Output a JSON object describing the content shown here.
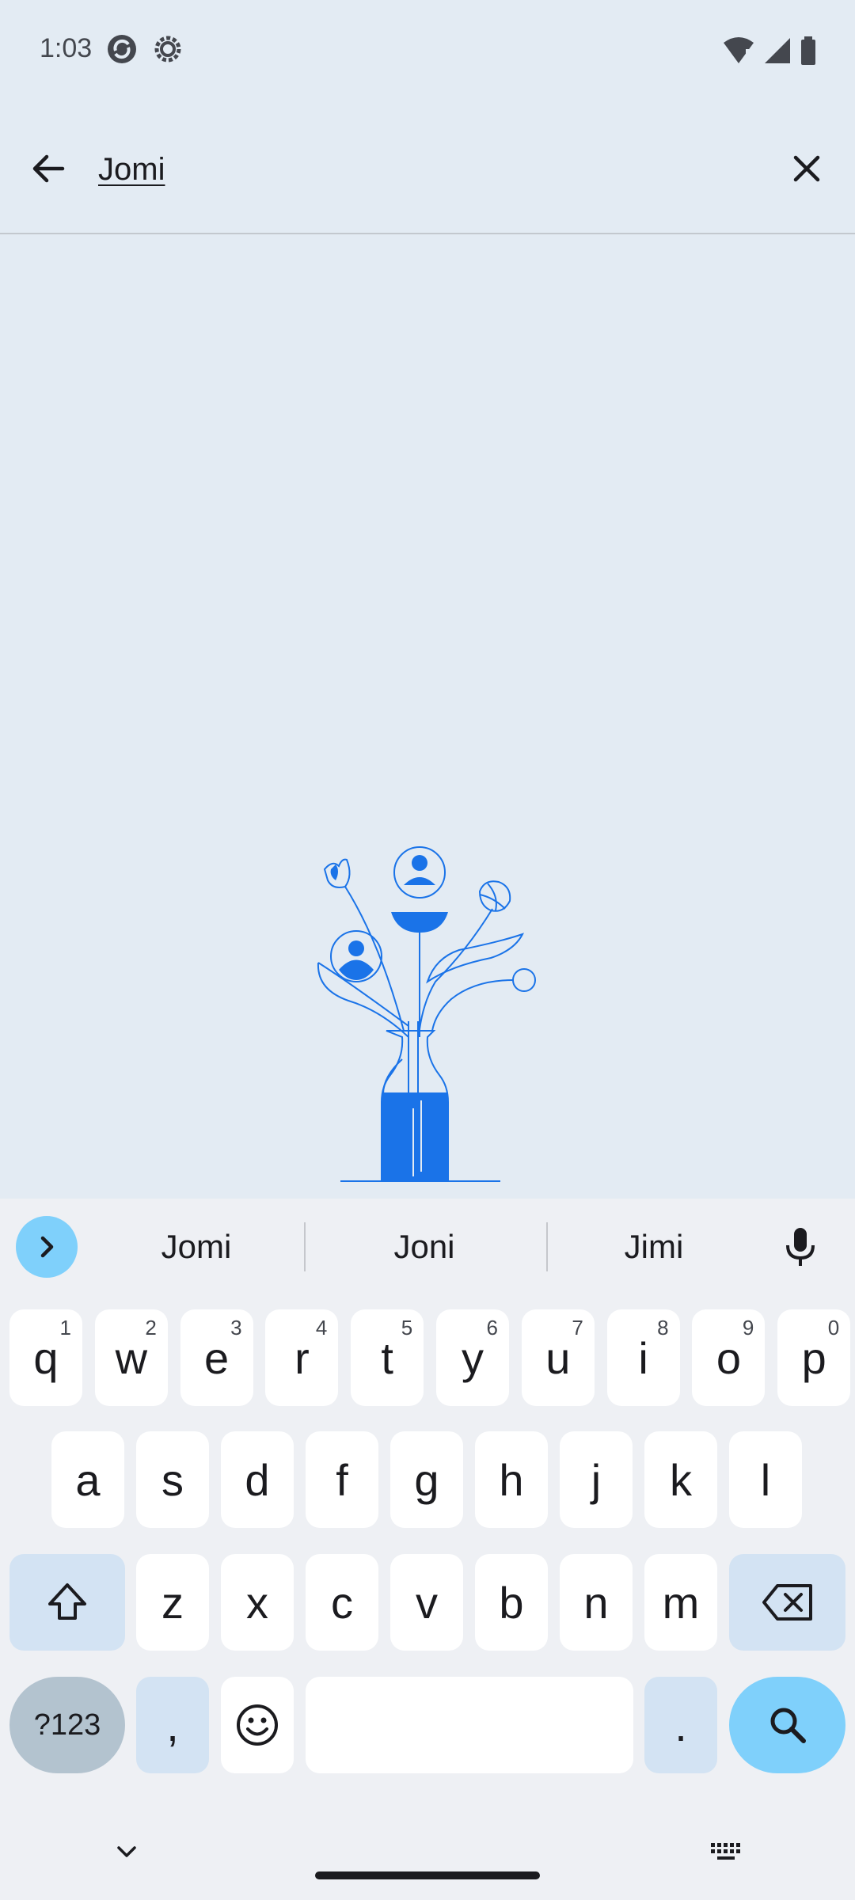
{
  "status_bar": {
    "time": "1:03"
  },
  "search": {
    "query": "Jomi"
  },
  "keyboard": {
    "suggestions": [
      "Jomi",
      "Joni",
      "Jimi"
    ],
    "row1": [
      {
        "key": "q",
        "hint": "1"
      },
      {
        "key": "w",
        "hint": "2"
      },
      {
        "key": "e",
        "hint": "3"
      },
      {
        "key": "r",
        "hint": "4"
      },
      {
        "key": "t",
        "hint": "5"
      },
      {
        "key": "y",
        "hint": "6"
      },
      {
        "key": "u",
        "hint": "7"
      },
      {
        "key": "i",
        "hint": "8"
      },
      {
        "key": "o",
        "hint": "9"
      },
      {
        "key": "p",
        "hint": "0"
      }
    ],
    "row2": [
      "a",
      "s",
      "d",
      "f",
      "g",
      "h",
      "j",
      "k",
      "l"
    ],
    "row3": [
      "z",
      "x",
      "c",
      "v",
      "b",
      "n",
      "m"
    ],
    "symbols_label": "?123",
    "comma": ",",
    "period": "."
  },
  "colors": {
    "accent": "#1a73e8",
    "background": "#e3ebf3",
    "keyboard_accent": "#7fd0fb"
  }
}
